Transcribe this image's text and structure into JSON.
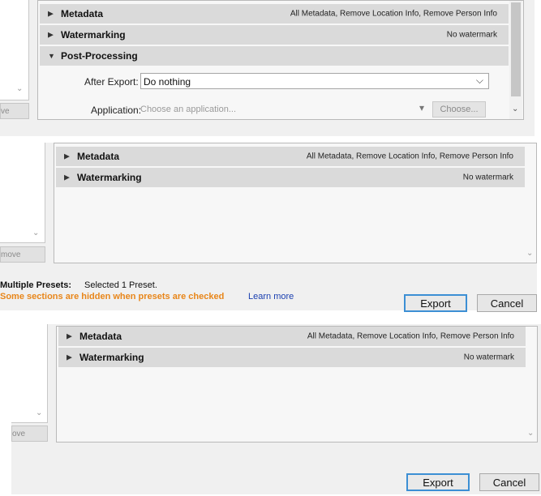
{
  "panel1": {
    "sections": [
      {
        "title": "Metadata",
        "summary": "All Metadata, Remove Location Info, Remove Person Info"
      },
      {
        "title": "Watermarking",
        "summary": "No watermark"
      },
      {
        "title": "Post-Processing",
        "summary": ""
      }
    ],
    "after_export_label": "After Export:",
    "after_export_value": "Do nothing",
    "application_label": "Application:",
    "application_placeholder": "Choose an application...",
    "choose_button": "Choose...",
    "remove_button": "ve"
  },
  "panel2": {
    "sections": [
      {
        "title": "Metadata",
        "summary": "All Metadata, Remove Location Info, Remove Person Info"
      },
      {
        "title": "Watermarking",
        "summary": "No watermark"
      }
    ],
    "remove_button": "move",
    "multiple_presets_label": "Multiple Presets:",
    "multiple_presets_value": "Selected 1 Preset.",
    "warning": "Some sections are hidden when presets are checked",
    "learn_more": "Learn more",
    "export_button": "Export",
    "cancel_button": "Cancel"
  },
  "panel3": {
    "sections": [
      {
        "title": "Metadata",
        "summary": "All Metadata, Remove Location Info, Remove Person Info"
      },
      {
        "title": "Watermarking",
        "summary": "No watermark"
      }
    ],
    "remove_button": "ove",
    "export_button": "Export",
    "cancel_button": "Cancel"
  },
  "icons": {
    "collapsed": "▶",
    "expanded": "▼",
    "scroll_down": "⌄",
    "dropdown": "⌵",
    "dropdown_small": "▾"
  },
  "colors": {
    "warning": "#e8861a",
    "link": "#1a3fb0",
    "accent": "#3c8fd4"
  }
}
